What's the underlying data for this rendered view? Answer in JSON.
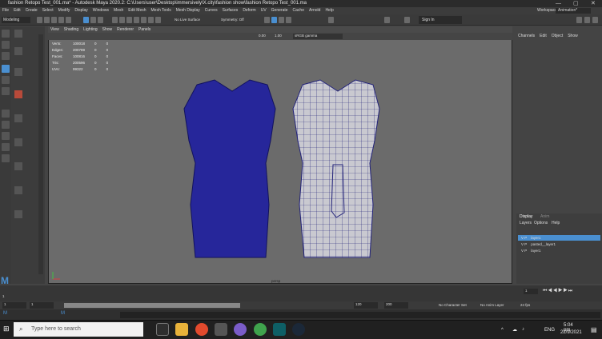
{
  "titlebar": {
    "title": "fashion Retopo Test_001.ma* - Autodesk Maya 2020.2: C:\\Users\\user\\Desktop\\immersively\\X.city\\fashion show\\fashion Retopo Test_001.ma",
    "minimize": "—",
    "maximize": "▢",
    "close": "✕"
  },
  "menubar": {
    "items": [
      "File",
      "Edit",
      "Create",
      "Select",
      "Modify",
      "Display",
      "Windows",
      "Mesh",
      "Edit Mesh",
      "Mesh Tools",
      "Mesh Display",
      "Curves",
      "Surfaces",
      "Deform",
      "UV",
      "Generate",
      "Cache",
      "Arnold",
      "Help"
    ],
    "workspace_label": "Workspace:",
    "workspace_value": "Animation*"
  },
  "shelf": {
    "mode": "Modeling",
    "no_live_surface": "No Live Surface",
    "symmetry": "Symmetry: Off",
    "sign_in": "Sign In"
  },
  "viewport": {
    "menu": [
      "View",
      "Shading",
      "Lighting",
      "Show",
      "Renderer",
      "Panels"
    ],
    "gamma_value": "1.00",
    "exposure_value": "0.00",
    "color_space": "sRGB gamma",
    "camera_label": "persp",
    "hud": {
      "rows": [
        {
          "label": "Verts:",
          "a": "100018",
          "b": "0",
          "c": "0"
        },
        {
          "label": "Edges:",
          "a": "200789",
          "b": "0",
          "c": "0"
        },
        {
          "label": "Faces:",
          "a": "100816",
          "b": "0",
          "c": "0"
        },
        {
          "label": "Tris:",
          "a": "200596",
          "b": "0",
          "c": "0"
        },
        {
          "label": "UVs:",
          "a": "99322",
          "b": "0",
          "c": "0"
        }
      ]
    }
  },
  "channel_box": {
    "tabs": [
      "Channels",
      "Edit",
      "Object",
      "Show"
    ]
  },
  "layers": {
    "tabs": [
      "Display",
      "Anim"
    ],
    "menu": [
      "Layers",
      "Options",
      "Help"
    ],
    "rows": [
      {
        "v": "V",
        "p": "P",
        "name": "layer1",
        "selected": true
      },
      {
        "v": "V",
        "p": "P",
        "name": "pasted__layer1",
        "selected": false
      },
      {
        "v": "V",
        "p": "P",
        "name": "layer1",
        "selected": false
      }
    ]
  },
  "timeline": {
    "start": "1",
    "current": "1",
    "range_start": "1",
    "range_end": "120",
    "end1": "120",
    "end2": "200",
    "character_set": "No Character Set",
    "anim_layer": "No Anim Layer",
    "fps": "24 fps",
    "frame_field": "1"
  },
  "taskbar": {
    "search_placeholder": "Type here to search",
    "lang": "ENG",
    "time": "5:04 pm",
    "date": "22/9/2021",
    "maya_tab_1": "M",
    "maya_tab_2": "M"
  },
  "colors": {
    "mesh_blue": "#1c1c8c",
    "accent": "#4a8fd0"
  }
}
